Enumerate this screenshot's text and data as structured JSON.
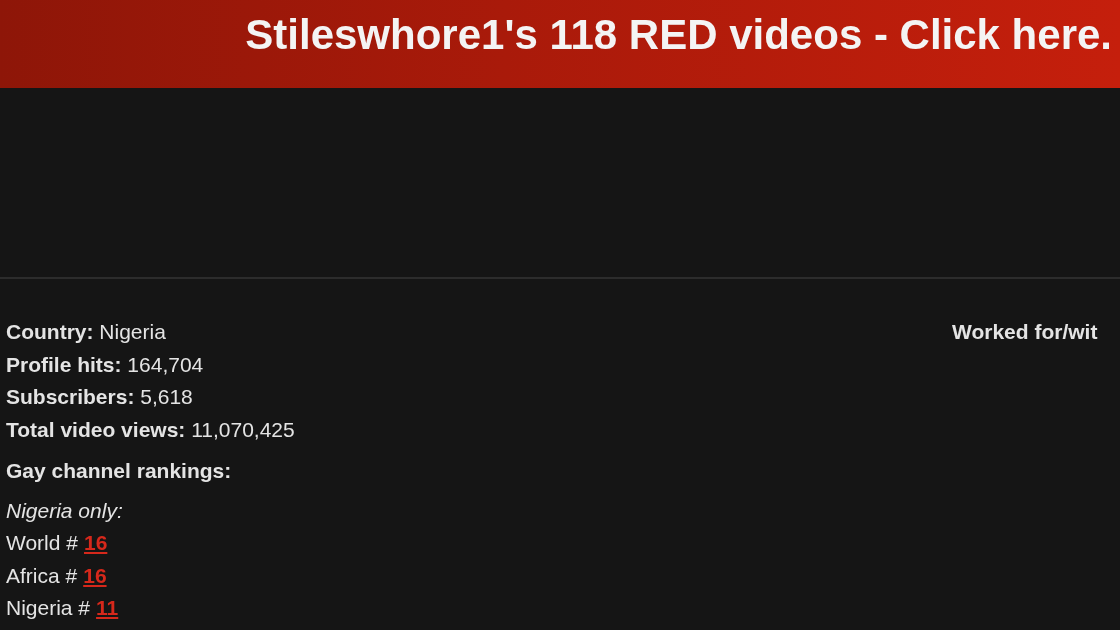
{
  "banner": {
    "text": "Stileswhore1's 118 RED videos - Click here."
  },
  "profile": {
    "fields": [
      {
        "label": "Country:",
        "value": "Nigeria"
      },
      {
        "label": "Profile hits:",
        "value": "164,704"
      },
      {
        "label": "Subscribers:",
        "value": "5,618"
      },
      {
        "label": "Total video views:",
        "value": "11,070,425"
      }
    ],
    "rankings": {
      "heading": "Gay channel rankings:",
      "scope": "Nigeria only:",
      "items": [
        {
          "label": "World #",
          "rank": "16"
        },
        {
          "label": "Africa #",
          "rank": "16"
        },
        {
          "label": "Nigeria #",
          "rank": "11"
        }
      ]
    }
  },
  "side": {
    "heading": "Worked for/wit"
  }
}
